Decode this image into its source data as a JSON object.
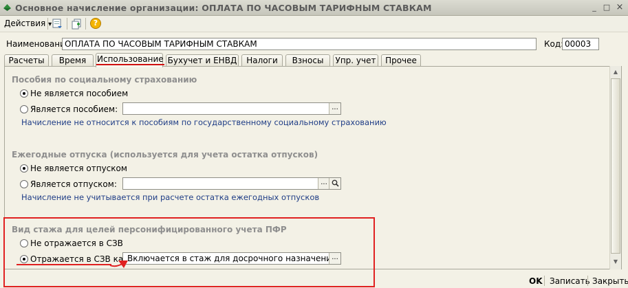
{
  "window": {
    "title": "Основное начисление организации: ОПЛАТА ПО ЧАСОВЫМ ТАРИФНЫМ СТАВКАМ",
    "controls": [
      "_",
      "□",
      "×"
    ]
  },
  "toolbar": {
    "actions_label": "Действия",
    "actions_arrow": "▾",
    "help_glyph": "?"
  },
  "header": {
    "name_label": "Наименование:",
    "name_value": "ОПЛАТА ПО ЧАСОВЫМ ТАРИФНЫМ СТАВКАМ",
    "code_label": "Код:",
    "code_value": "00003"
  },
  "tabs": [
    {
      "label": "Расчеты",
      "active": false
    },
    {
      "label": "Время",
      "active": false
    },
    {
      "label": "Использование",
      "active": true
    },
    {
      "label": "Бухучет и ЕНВД",
      "active": false
    },
    {
      "label": "Налоги",
      "active": false
    },
    {
      "label": "Взносы",
      "active": false
    },
    {
      "label": "Упр. учет",
      "active": false
    },
    {
      "label": "Прочее",
      "active": false
    }
  ],
  "sections": {
    "benefits": {
      "title": "Пособия по социальному страхованию",
      "option_not": "Не является пособием",
      "option_is": "Является пособием:",
      "value": "",
      "note": "Начисление не относится к пособиям по государственному социальному страхованию"
    },
    "vacations": {
      "title": "Ежегодные отпуска (используется для учета остатка отпусков)",
      "option_not": "Не является отпуском",
      "option_is": "Является отпуском:",
      "value": "",
      "note": "Начисление не учитывается при расчете остатка ежегодных отпусков"
    },
    "pfr": {
      "title": "Вид стажа для целей персонифицированного учета ПФР",
      "option_not": "Не отражается в СЗВ",
      "option_is": "Отражается в СЗВ как:",
      "value": "Включается в стаж для досрочного назначения пенсии"
    }
  },
  "buttons": {
    "ellipsis": "...",
    "ok": "OK",
    "save": "Записать",
    "close": "Закрыть"
  },
  "colors": {
    "annotation_red": "#e02020",
    "note_blue": "#1f3d86",
    "section_gray": "#8e8e8e"
  }
}
